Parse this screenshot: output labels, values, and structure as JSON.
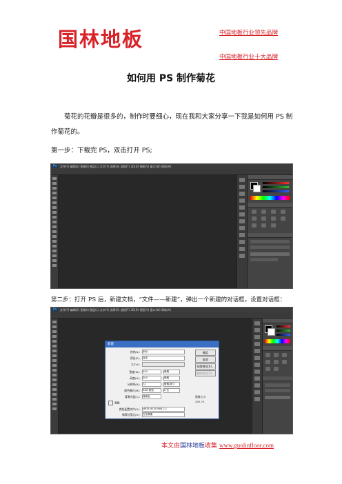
{
  "header": {
    "logo_text": "国林地板",
    "tagline_1": "中国地板行业领先品牌",
    "tagline_2": "中国地板行业十大品牌"
  },
  "article": {
    "title": "如何用 PS 制作菊花",
    "intro": "菊花的花瓣是很多的，制作时要细心，现在我和大家分享一下我是如何用 PS 制作菊花的。",
    "step1": "第一步：下载完 PS，双击打开 PS;",
    "step2": "第二步：打开 PS 后，新建文档，“文件——新建”，弹出一个新建的对话框，设置对话框："
  },
  "screenshot1": {
    "app_badge": "Ps",
    "menu_text": "文件(F)  编辑(E)  图像(I)  图层(L)  文字(Y)  选择(S)  滤镜(T)  3D(D)  视图(V)  窗口(W)  帮助(H)"
  },
  "screenshot2": {
    "app_badge": "Ps",
    "menu_text": "文件(F)  编辑(E)  图像(I)  图层(L)  文字(Y)  选择(S)  滤镜(T)  3D(D)  视图(V)  窗口(W)  帮助(H)",
    "dialog": {
      "title": "新建",
      "rows": [
        {
          "label": "名称(N):",
          "value": "未标",
          "unit": ""
        },
        {
          "label": "预设(P):",
          "value": "自定",
          "unit": ""
        },
        {
          "label": "大小(I):",
          "value": "",
          "unit": ""
        },
        {
          "label": "宽度(W):",
          "value": "300",
          "unit": "像素"
        },
        {
          "label": "高度(H):",
          "value": "300",
          "unit": "像素"
        },
        {
          "label": "分辨率(R):",
          "value": "72",
          "unit": "像素/英寸"
        },
        {
          "label": "颜色模式(M):",
          "value": "RGB 颜色",
          "unit": "8 位"
        },
        {
          "label": "背景内容(C):",
          "value": "背景色",
          "unit": ""
        }
      ],
      "advanced_label": "高级",
      "profile_label": "颜色配置文件(O):",
      "profile_value": "sRGB IEC61966-2.1",
      "aspect_label": "像素长宽比(X):",
      "aspect_value": "方形像素",
      "buttons": [
        "确定",
        "取消",
        "存储预设(S)...",
        "删除预设(D)..."
      ],
      "size_label": "图像大小:",
      "size_value": "263.7K"
    }
  },
  "footer": {
    "prefix": "本文由",
    "brand": "国林地板",
    "suffix": "收集",
    "url": "www.guolinfloor.com"
  }
}
